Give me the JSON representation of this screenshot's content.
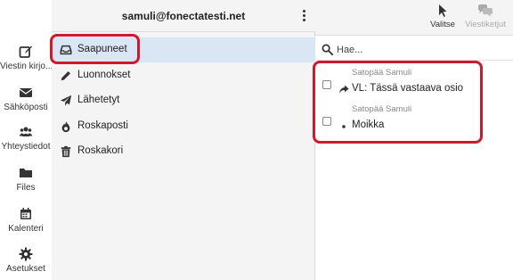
{
  "nav": [
    {
      "id": "compose",
      "icon": "compose-icon",
      "label": "Viestin kirjo..."
    },
    {
      "id": "email",
      "icon": "envelope-icon",
      "label": "Sähköposti"
    },
    {
      "id": "contacts",
      "icon": "contacts-icon",
      "label": "Yhteystiedot"
    },
    {
      "id": "files",
      "icon": "folder-icon",
      "label": "Files"
    },
    {
      "id": "calendar",
      "icon": "calendar-icon",
      "label": "Kalenteri"
    },
    {
      "id": "settings",
      "icon": "gear-icon",
      "label": "Asetukset"
    }
  ],
  "account": {
    "email": "samuli@fonectatesti.net"
  },
  "folders": [
    {
      "id": "inbox",
      "icon": "inbox-icon",
      "label": "Saapuneet",
      "selected": true
    },
    {
      "id": "drafts",
      "icon": "pencil-icon",
      "label": "Luonnokset"
    },
    {
      "id": "sent",
      "icon": "paper-plane-icon",
      "label": "Lähetetyt"
    },
    {
      "id": "junk",
      "icon": "fire-icon",
      "label": "Roskaposti"
    },
    {
      "id": "trash",
      "icon": "trash-icon",
      "label": "Roskakori"
    }
  ],
  "toolbar": {
    "select_label": "Valitse",
    "threads_label": "Viestiketjut"
  },
  "search": {
    "placeholder": "Hae..."
  },
  "messages": [
    {
      "sender": "Satopää Samuli",
      "subject": "VL: Tässä vastaava osio",
      "status": "forwarded"
    },
    {
      "sender": "Satopää Samuli",
      "subject": "Moikka",
      "status": "unread"
    }
  ],
  "colors": {
    "highlight": "#cc1b2e",
    "selected_folder": "#dbe6f5",
    "panel_bg": "#f4f4f4"
  }
}
